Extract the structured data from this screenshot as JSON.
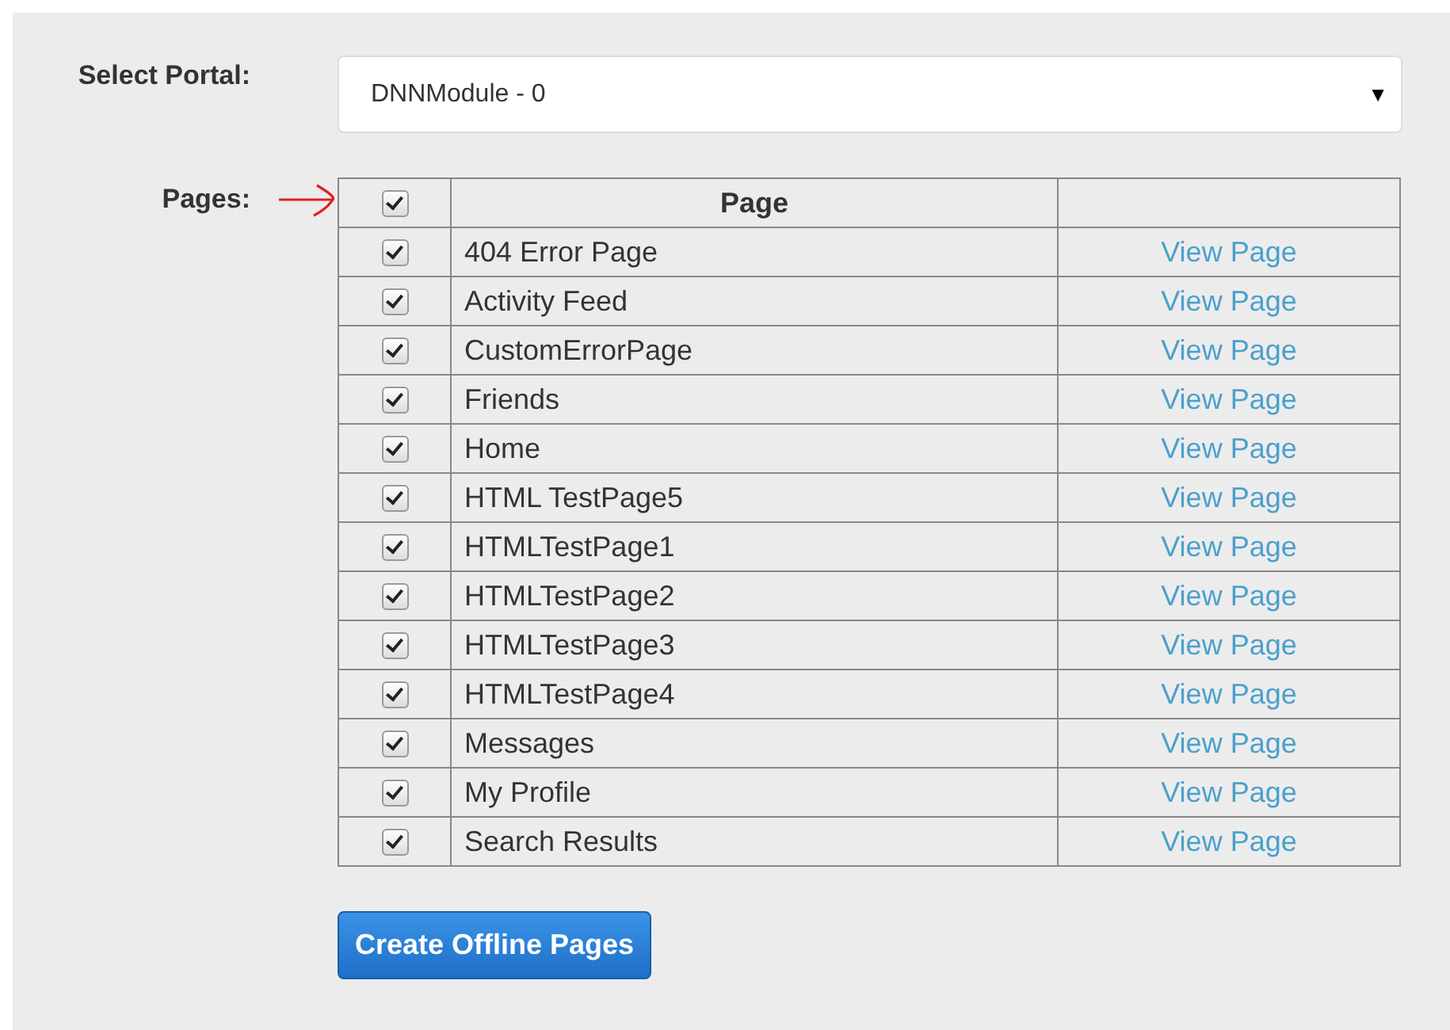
{
  "portal": {
    "label": "Select Portal:",
    "value": "DNNModule - 0",
    "caret": "▼"
  },
  "pages": {
    "label": "Pages:",
    "header": {
      "checked": true,
      "column": "Page"
    },
    "rows": [
      {
        "name": "404 Error Page",
        "checked": true,
        "link": "View Page"
      },
      {
        "name": "Activity Feed",
        "checked": true,
        "link": "View Page"
      },
      {
        "name": "CustomErrorPage",
        "checked": true,
        "link": "View Page"
      },
      {
        "name": "Friends",
        "checked": true,
        "link": "View Page"
      },
      {
        "name": "Home",
        "checked": true,
        "link": "View Page"
      },
      {
        "name": "HTML TestPage5",
        "checked": true,
        "link": "View Page"
      },
      {
        "name": "HTMLTestPage1",
        "checked": true,
        "link": "View Page"
      },
      {
        "name": "HTMLTestPage2",
        "checked": true,
        "link": "View Page"
      },
      {
        "name": "HTMLTestPage3",
        "checked": true,
        "link": "View Page"
      },
      {
        "name": "HTMLTestPage4",
        "checked": true,
        "link": "View Page"
      },
      {
        "name": "Messages",
        "checked": true,
        "link": "View Page"
      },
      {
        "name": "My Profile",
        "checked": true,
        "link": "View Page"
      },
      {
        "name": "Search Results",
        "checked": true,
        "link": "View Page"
      }
    ]
  },
  "button": "Create Offline Pages"
}
